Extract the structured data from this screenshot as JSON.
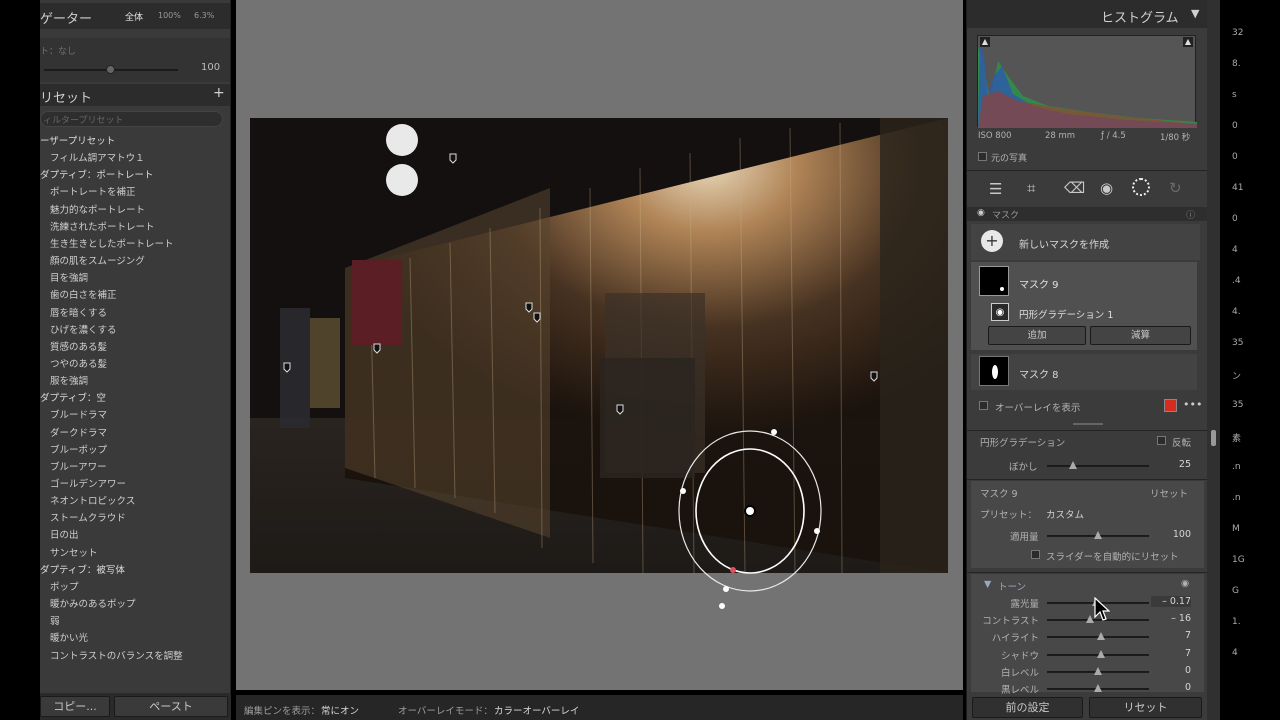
{
  "navigator": {
    "title": "ゲーター",
    "zoom_options": [
      "全体",
      "100%",
      "6.3%"
    ],
    "subtitle": "ト：なし",
    "amount_value": "100"
  },
  "presets": {
    "title": "リセット",
    "add_label": "+",
    "search_placeholder": "ィルタープリセット",
    "items": [
      {
        "label": "ーザープリセット",
        "group": true
      },
      {
        "label": "フィルム調アマトウ１",
        "group": false
      },
      {
        "label": "ダプティブ：ポートレート",
        "group": true
      },
      {
        "label": "ポートレートを補正",
        "group": false
      },
      {
        "label": "魅力的なポートレート",
        "group": false
      },
      {
        "label": "洗練されたポートレート",
        "group": false
      },
      {
        "label": "生き生きとしたポートレート",
        "group": false
      },
      {
        "label": "顔の肌をスムージング",
        "group": false
      },
      {
        "label": "目を強調",
        "group": false
      },
      {
        "label": "歯の白さを補正",
        "group": false
      },
      {
        "label": "唇を暗くする",
        "group": false
      },
      {
        "label": "ひげを濃くする",
        "group": false
      },
      {
        "label": "質感のある髪",
        "group": false
      },
      {
        "label": "つやのある髪",
        "group": false
      },
      {
        "label": "服を強調",
        "group": false
      },
      {
        "label": "ダプティブ：空",
        "group": true
      },
      {
        "label": "ブルードラマ",
        "group": false
      },
      {
        "label": "ダークドラマ",
        "group": false
      },
      {
        "label": "ブルーポップ",
        "group": false
      },
      {
        "label": "ブルーアワー",
        "group": false
      },
      {
        "label": "ゴールデンアワー",
        "group": false
      },
      {
        "label": "ネオントロピックス",
        "group": false
      },
      {
        "label": "ストームクラウド",
        "group": false
      },
      {
        "label": "日の出",
        "group": false
      },
      {
        "label": "サンセット",
        "group": false
      },
      {
        "label": "ダプティブ：被写体",
        "group": true
      },
      {
        "label": "ポップ",
        "group": false
      },
      {
        "label": "暖かみのあるポップ",
        "group": false
      },
      {
        "label": "弱",
        "group": false
      },
      {
        "label": "暖かい光",
        "group": false
      },
      {
        "label": "コントラストのバランスを調整",
        "group": false
      }
    ],
    "copy_label": "コピー...",
    "paste_label": "ペースト"
  },
  "toolbar_bottom": {
    "pin_label": "編集ピンを表示：",
    "pin_value": "常にオン",
    "overlay_label": "オーバーレイモード：",
    "overlay_value": "カラーオーバーレイ"
  },
  "histogram": {
    "title": "ヒストグラム",
    "iso": "ISO 800",
    "focal": "28 mm",
    "aperture": "ƒ / 4.5",
    "shutter": "1/80 秒",
    "original_photo_label": "元の写真"
  },
  "tools": [
    "sliders-icon",
    "crop-icon",
    "heal-icon",
    "redeye-icon",
    "mask-icon",
    "history-icon"
  ],
  "masks": {
    "title": "マスク",
    "create_new": "新しいマスクを作成",
    "mask9_label": "マスク 9",
    "component_label": "円形グラデーション 1",
    "add_label": "追加",
    "subtract_label": "減算",
    "mask8_label": "マスク 8",
    "overlay_label": "オーバーレイを表示",
    "overlay_color": "#d62b1f"
  },
  "radial": {
    "title": "円形グラデーション",
    "invert_label": "反転",
    "feather_label": "ぼかし",
    "feather_value": "25",
    "feather_pct": 25
  },
  "mask_settings": {
    "title": "マスク 9",
    "reset_label": "リセット",
    "preset_label": "プリセット：",
    "preset_value": "カスタム",
    "amount_label": "適用量",
    "amount_value": "100",
    "auto_reset_label": "スライダーを自動的にリセット"
  },
  "tone": {
    "title": "トーン",
    "sliders": [
      {
        "label": "露光量",
        "value": "– 0.17",
        "pct": 48
      },
      {
        "label": "コントラスト",
        "value": "– 16",
        "pct": 42
      },
      {
        "label": "ハイライト",
        "value": "7",
        "pct": 53
      },
      {
        "label": "シャドウ",
        "value": "7",
        "pct": 53
      },
      {
        "label": "白レベル",
        "value": "0",
        "pct": 50
      },
      {
        "label": "黒レベル",
        "value": "0",
        "pct": 50
      }
    ]
  },
  "footer_right": {
    "previous_label": "前の設定",
    "reset_label": "リセット"
  },
  "far_right_chars": [
    "32",
    "8.",
    "s",
    "0",
    "0",
    "41",
    "0",
    "4",
    ".4",
    "4.",
    "35",
    "ン",
    "35",
    "素",
    ".n",
    ".n",
    "M",
    "1G",
    "G",
    "1.",
    "4"
  ]
}
